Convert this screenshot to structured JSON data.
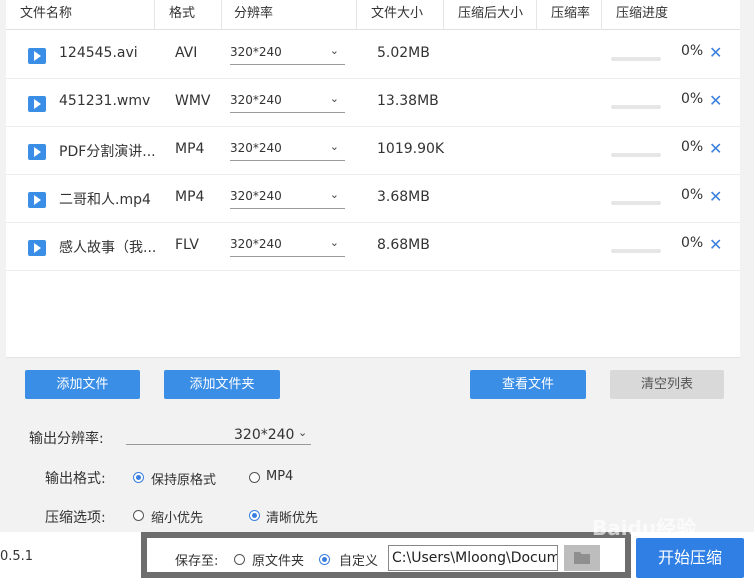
{
  "table": {
    "headers": [
      "文件名称",
      "格式",
      "分辨率",
      "文件大小",
      "压缩后大小",
      "压缩率",
      "压缩进度"
    ],
    "rows": [
      {
        "name": "124545.avi",
        "format": "AVI",
        "resolution": "320*240",
        "size": "5.02MB",
        "progress_pct": "0%",
        "progress": 0
      },
      {
        "name": "451231.wmv",
        "format": "WMV",
        "resolution": "320*240",
        "size": "13.38MB",
        "progress_pct": "0%",
        "progress": 0
      },
      {
        "name": "PDF分割演讲...",
        "format": "MP4",
        "resolution": "320*240",
        "size": "1019.90KB",
        "progress_pct": "0%",
        "progress": 0
      },
      {
        "name": "二哥和人.mp4",
        "format": "MP4",
        "resolution": "320*240",
        "size": "3.68MB",
        "progress_pct": "0%",
        "progress": 0
      },
      {
        "name": "感人故事（我...",
        "format": "FLV",
        "resolution": "320*240",
        "size": "8.68MB",
        "progress_pct": "0%",
        "progress": 0
      }
    ]
  },
  "actions": {
    "add_file": "添加文件",
    "add_folder": "添加文件夹",
    "view_file": "查看文件",
    "clear_list": "清空列表"
  },
  "settings": {
    "output_resolution_label": "输出分辨率:",
    "output_resolution_value": "320*240",
    "output_format_label": "输出格式:",
    "format_keep": "保持原格式",
    "format_mp4": "MP4",
    "compress_label": "压缩选项:",
    "compress_small": "缩小优先",
    "compress_clear": "清晰优先"
  },
  "bottom": {
    "version": "0.5.1",
    "save_to_label": "保存至:",
    "save_original": "原文件夹",
    "save_custom": "自定义",
    "path": "C:\\Users\\Mloong\\Documents",
    "start": "开始压缩",
    "watermark": "Baidu经验"
  },
  "colors": {
    "accent": "#3a8ee6",
    "disabled": "#d9d9d9"
  }
}
